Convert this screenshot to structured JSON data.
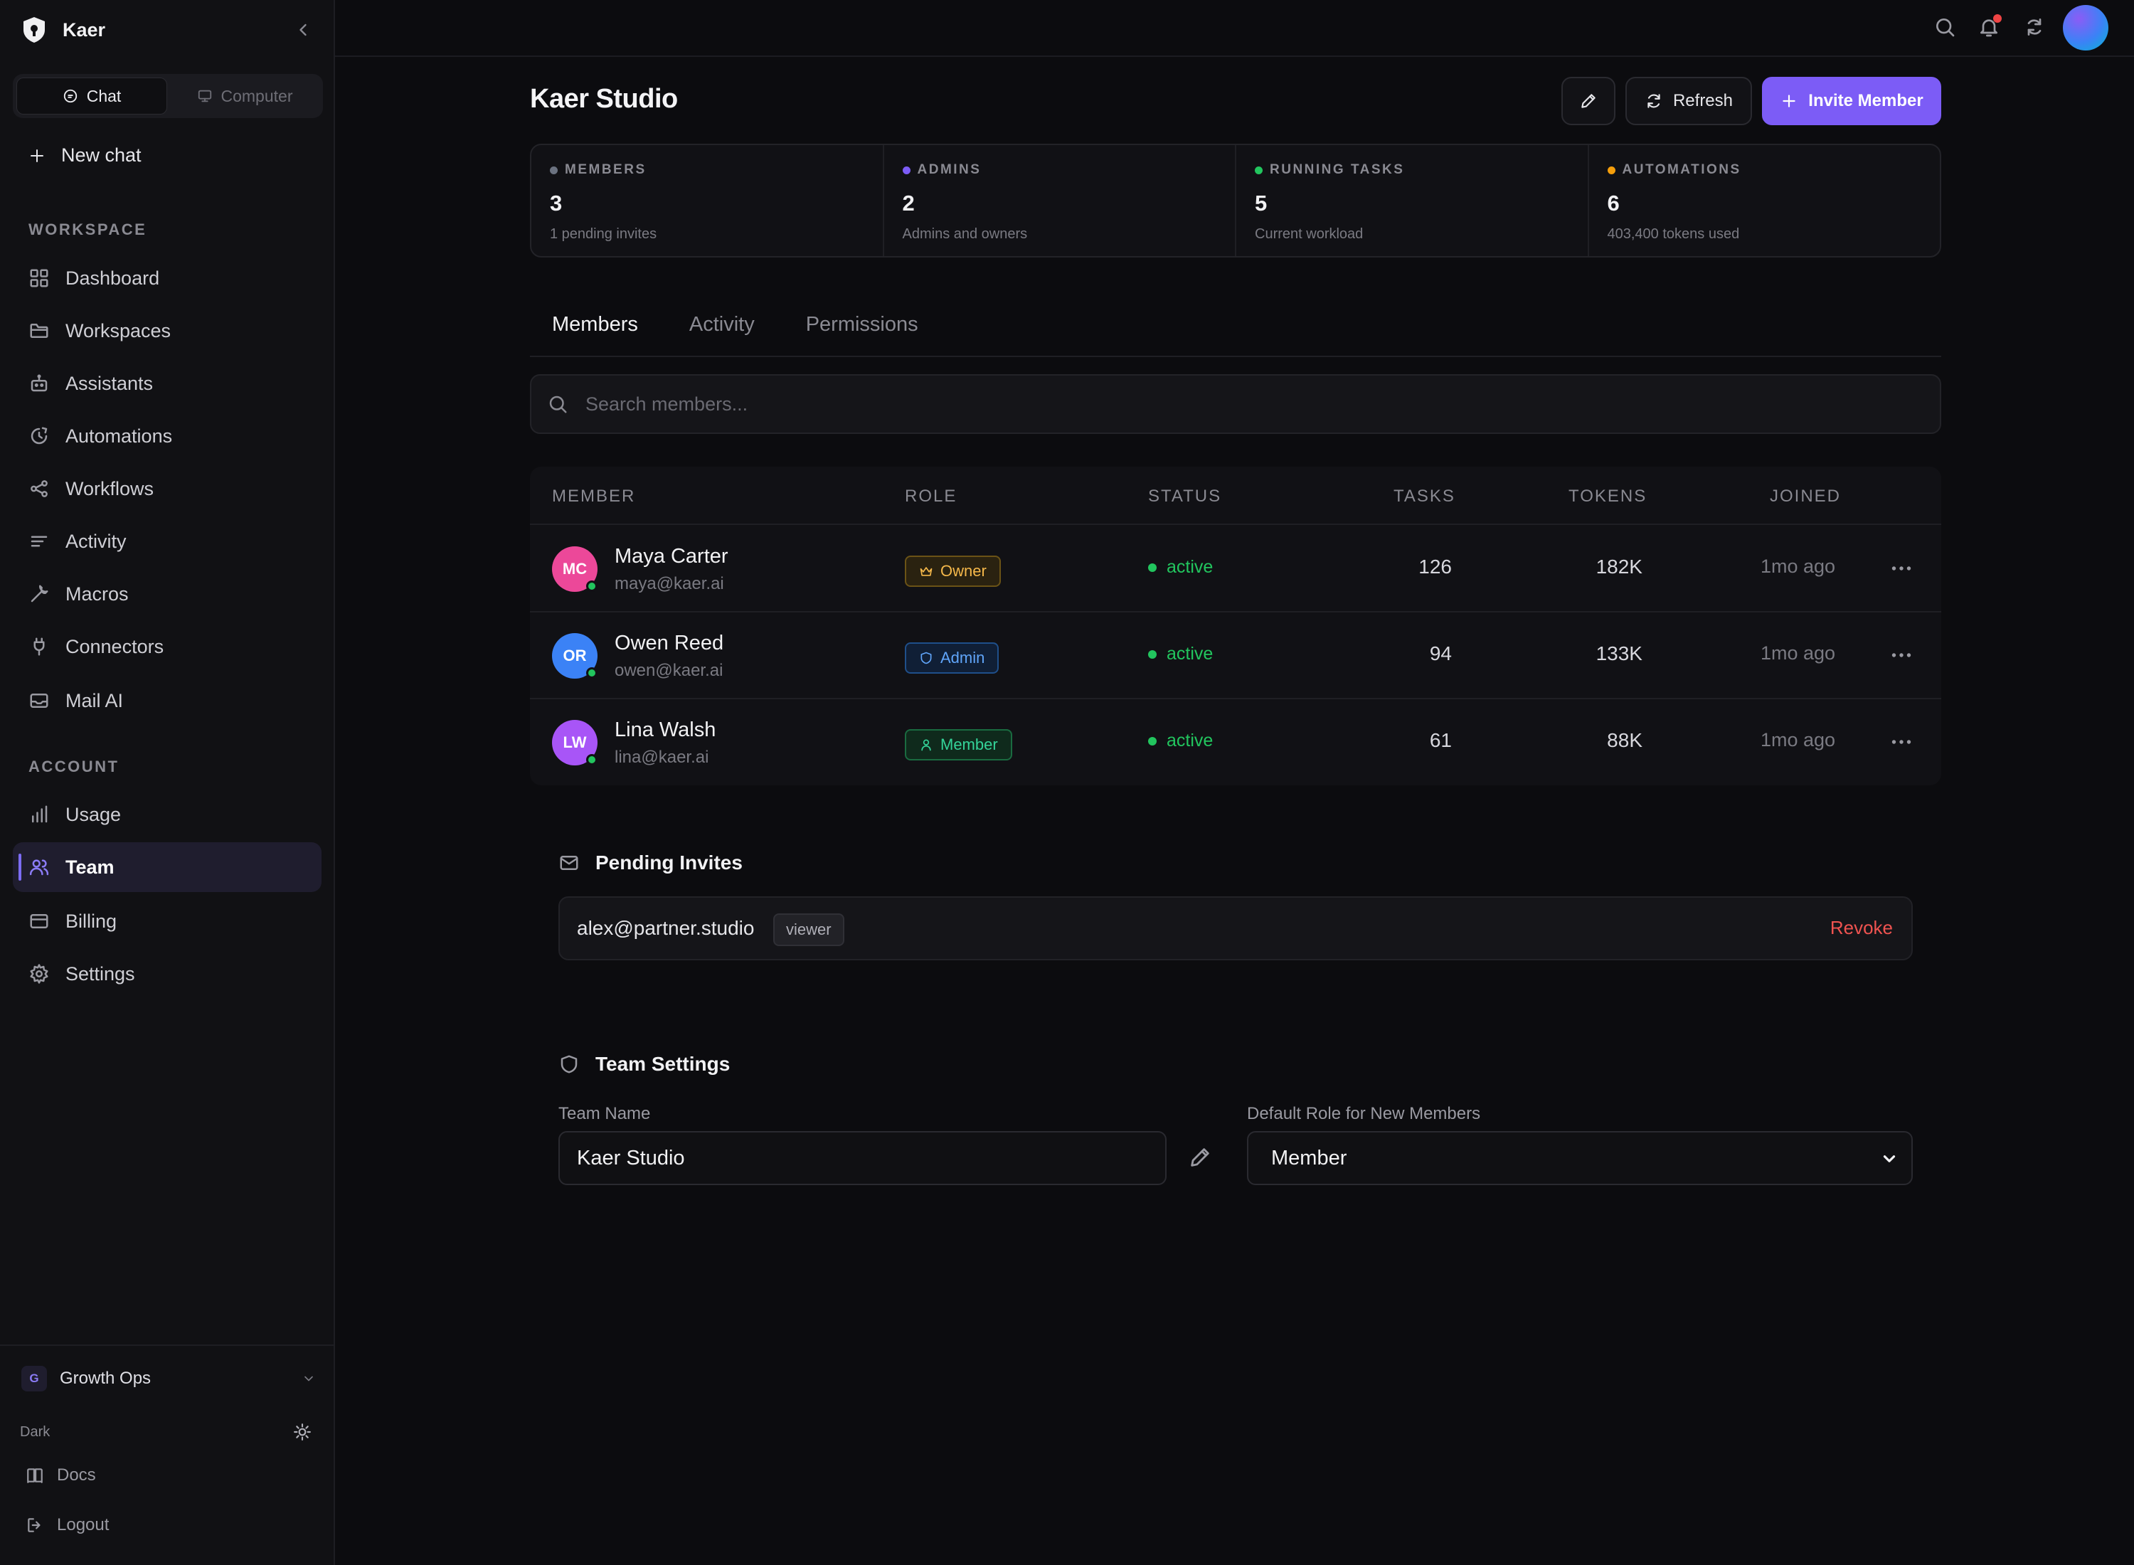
{
  "app": {
    "name": "Kaer"
  },
  "modes": [
    {
      "label": "Chat",
      "icon": "chat-icon"
    },
    {
      "label": "Computer",
      "icon": "monitor-icon"
    }
  ],
  "sidebar": {
    "new_chat": "New chat",
    "workspace_heading": "WORKSPACE",
    "workspace_items": [
      {
        "label": "Dashboard",
        "icon": "dashboard-icon"
      },
      {
        "label": "Workspaces",
        "icon": "folder-icon"
      },
      {
        "label": "Assistants",
        "icon": "bot-icon"
      },
      {
        "label": "Automations",
        "icon": "clock-icon"
      },
      {
        "label": "Workflows",
        "icon": "share-icon"
      },
      {
        "label": "Activity",
        "icon": "list-icon"
      },
      {
        "label": "Macros",
        "icon": "wrench-icon"
      },
      {
        "label": "Connectors",
        "icon": "plug-icon"
      },
      {
        "label": "Mail AI",
        "icon": "inbox-icon"
      }
    ],
    "account_heading": "ACCOUNT",
    "account_items": [
      {
        "label": "Usage",
        "icon": "bar-chart-icon"
      },
      {
        "label": "Team",
        "icon": "users-icon",
        "active": true
      },
      {
        "label": "Billing",
        "icon": "credit-card-icon"
      },
      {
        "label": "Settings",
        "icon": "gear-icon"
      }
    ],
    "org": {
      "initial": "G",
      "name": "Growth Ops"
    },
    "theme_label": "Dark",
    "docs": "Docs",
    "logout": "Logout"
  },
  "page": {
    "title": "Kaer Studio",
    "refresh": "Refresh",
    "invite": "Invite Member"
  },
  "stats": [
    {
      "label": "MEMBERS",
      "value": "3",
      "sub": "1 pending invites",
      "color": "#6b7280"
    },
    {
      "label": "ADMINS",
      "value": "2",
      "sub": "Admins and owners",
      "color": "#7c5cf6"
    },
    {
      "label": "RUNNING TASKS",
      "value": "5",
      "sub": "Current workload",
      "color": "#22c55e"
    },
    {
      "label": "AUTOMATIONS",
      "value": "6",
      "sub": "403,400 tokens used",
      "color": "#f59e0b"
    }
  ],
  "tabs": [
    "Members",
    "Activity",
    "Permissions"
  ],
  "search": {
    "placeholder": "Search members..."
  },
  "table": {
    "headers": {
      "member": "MEMBER",
      "role": "ROLE",
      "status": "STATUS",
      "tasks": "TASKS",
      "tokens": "TOKENS",
      "joined": "JOINED"
    },
    "rows": [
      {
        "initials": "MC",
        "name": "Maya Carter",
        "email": "maya@kaer.ai",
        "role": "Owner",
        "status": "active",
        "tasks": "126",
        "tokens": "182K",
        "joined": "1mo ago",
        "avatar_color": "#ec4899"
      },
      {
        "initials": "OR",
        "name": "Owen Reed",
        "email": "owen@kaer.ai",
        "role": "Admin",
        "status": "active",
        "tasks": "94",
        "tokens": "133K",
        "joined": "1mo ago",
        "avatar_color": "#3b82f6"
      },
      {
        "initials": "LW",
        "name": "Lina Walsh",
        "email": "lina@kaer.ai",
        "role": "Member",
        "status": "active",
        "tasks": "61",
        "tokens": "88K",
        "joined": "1mo ago",
        "avatar_color": "#a855f7"
      }
    ]
  },
  "pending": {
    "title": "Pending Invites",
    "invites": [
      {
        "email": "alex@partner.studio",
        "role": "viewer",
        "action": "Revoke"
      }
    ]
  },
  "team_settings": {
    "title": "Team Settings",
    "name_label": "Team Name",
    "name_value": "Kaer Studio",
    "role_label": "Default Role for New Members",
    "role_value": "Member"
  }
}
